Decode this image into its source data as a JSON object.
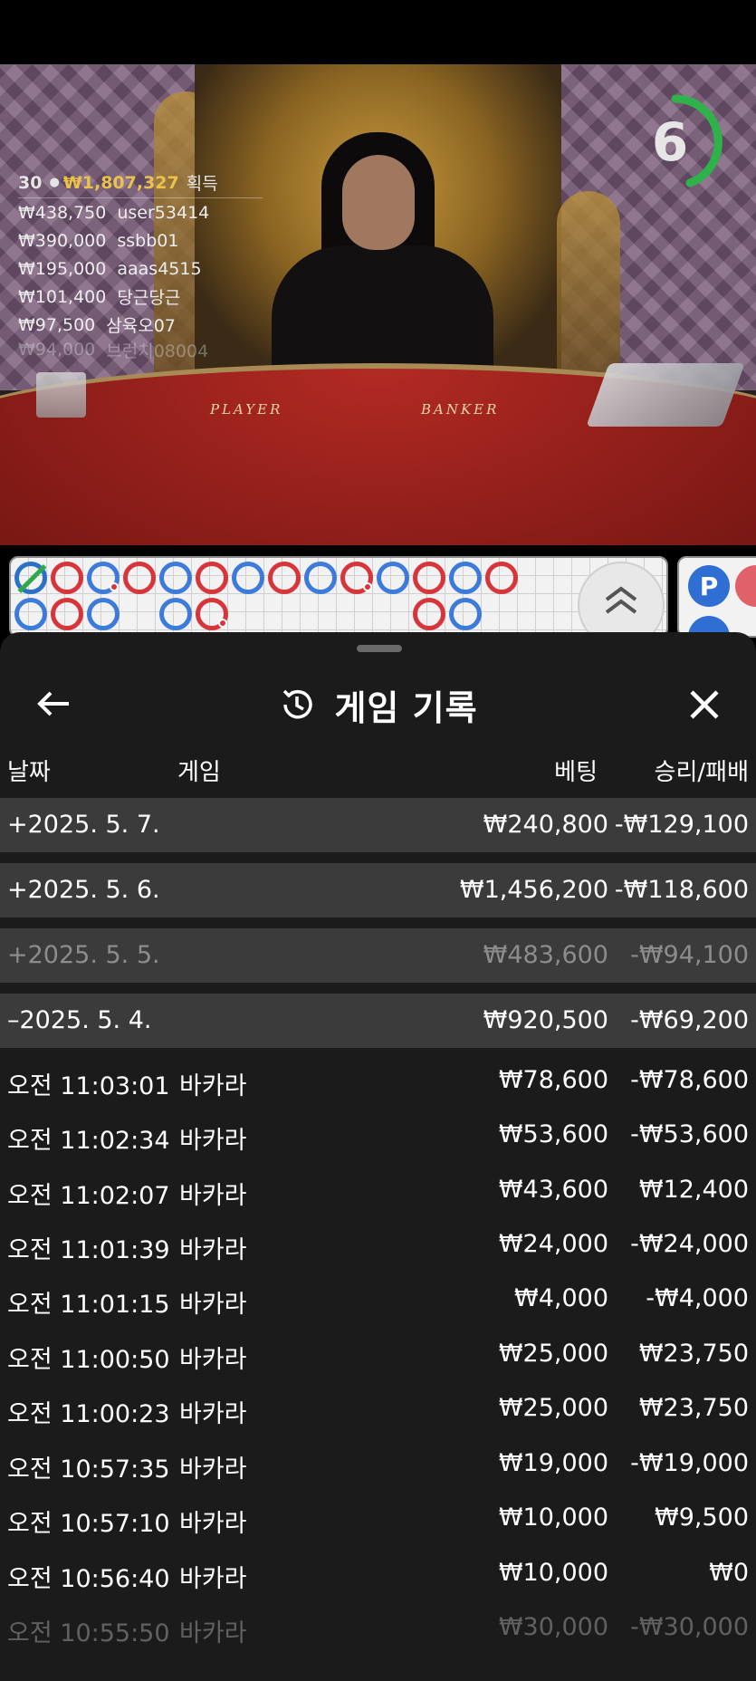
{
  "timer": {
    "value": "6"
  },
  "winners": {
    "count": "30",
    "total": "₩1,807,327",
    "suffix": "획득",
    "rows": [
      {
        "amount": "₩438,750",
        "user": "user53414"
      },
      {
        "amount": "₩390,000",
        "user": "ssbb01"
      },
      {
        "amount": "₩195,000",
        "user": "aaas4515"
      },
      {
        "amount": "₩101,400",
        "user": "당근당근"
      },
      {
        "amount": "₩97,500",
        "user": "삼육오07"
      },
      {
        "amount": "₩94,000",
        "user": "브런치08004"
      }
    ]
  },
  "table": {
    "player": "PLAYER",
    "banker": "BANKER"
  },
  "predict": {
    "player_label": "P"
  },
  "sheet": {
    "title": "게임 기록",
    "columns": {
      "date": "날짜",
      "game": "게임",
      "bet": "베팅",
      "result": "승리/패배"
    },
    "days": [
      {
        "date": "+2025. 5. 7.",
        "bet": "₩240,800",
        "result": "-₩129,100"
      },
      {
        "date": "+2025. 5. 6.",
        "bet": "₩1,456,200",
        "result": "-₩118,600"
      },
      {
        "date": "+2025. 5. 5.",
        "bet": "₩483,600",
        "result": "-₩94,100"
      },
      {
        "date": "–2025. 5. 4.",
        "bet": "₩920,500",
        "result": "-₩69,200"
      }
    ],
    "games": [
      {
        "time": "오전 11:03:01",
        "game": "바카라",
        "bet": "₩78,600",
        "result": "-₩78,600"
      },
      {
        "time": "오전 11:02:34",
        "game": "바카라",
        "bet": "₩53,600",
        "result": "-₩53,600"
      },
      {
        "time": "오전 11:02:07",
        "game": "바카라",
        "bet": "₩43,600",
        "result": "₩12,400"
      },
      {
        "time": "오전 11:01:39",
        "game": "바카라",
        "bet": "₩24,000",
        "result": "-₩24,000"
      },
      {
        "time": "오전 11:01:15",
        "game": "바카라",
        "bet": "₩4,000",
        "result": "-₩4,000"
      },
      {
        "time": "오전 11:00:50",
        "game": "바카라",
        "bet": "₩25,000",
        "result": "₩23,750"
      },
      {
        "time": "오전 11:00:23",
        "game": "바카라",
        "bet": "₩25,000",
        "result": "₩23,750"
      },
      {
        "time": "오전 10:57:35",
        "game": "바카라",
        "bet": "₩19,000",
        "result": "-₩19,000"
      },
      {
        "time": "오전 10:57:10",
        "game": "바카라",
        "bet": "₩10,000",
        "result": "₩9,500"
      },
      {
        "time": "오전 10:56:40",
        "game": "바카라",
        "bet": "₩10,000",
        "result": "₩0"
      },
      {
        "time": "오전 10:55:50",
        "game": "바카라",
        "bet": "₩30,000",
        "result": "-₩30,000"
      }
    ]
  },
  "icons": {
    "back": "arrow-left-icon",
    "history": "history-icon",
    "close": "close-icon",
    "expand": "chevron-double-up-icon"
  },
  "colors": {
    "sheet_bg": "#1b1b1b",
    "day_row_bg": "#3b3b3b",
    "winner_total": "#e8c24a",
    "banker_red": "#d7343b",
    "player_blue": "#3c7bd9",
    "timer_green": "#2fb24a"
  }
}
